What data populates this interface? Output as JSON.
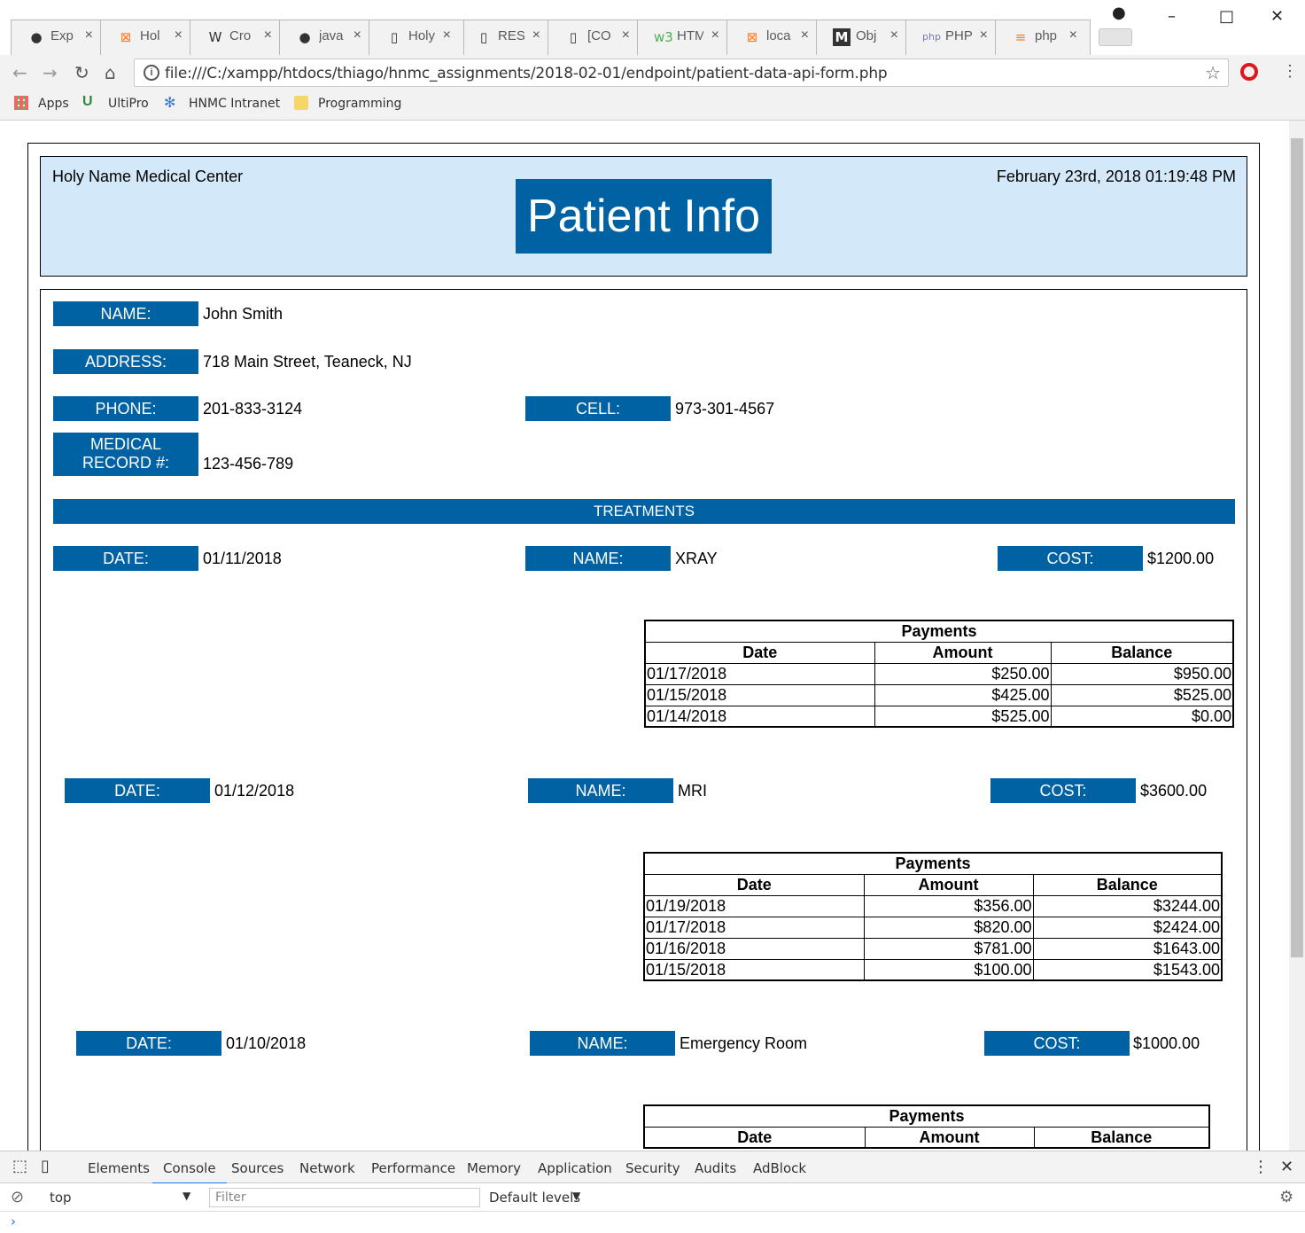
{
  "browser": {
    "tabs": [
      {
        "icon": "github-icon",
        "title": "Exp"
      },
      {
        "icon": "xampp-icon",
        "title": "Hol"
      },
      {
        "icon": "wikipedia-icon",
        "title": "Cro"
      },
      {
        "icon": "github-icon",
        "title": "java"
      },
      {
        "icon": "page-icon",
        "title": "Holy"
      },
      {
        "icon": "page-icon",
        "title": "RES"
      },
      {
        "icon": "page-icon",
        "title": "[CO"
      },
      {
        "icon": "w3-icon",
        "title": "HTM"
      },
      {
        "icon": "xampp-icon",
        "title": "loca"
      },
      {
        "icon": "medium-icon",
        "title": "Obj"
      },
      {
        "icon": "php-icon",
        "title": "PHP"
      },
      {
        "icon": "stackoverflow-icon",
        "title": "php"
      }
    ],
    "url": "file:///C:/xampp/htdocs/thiago/hnmc_assignments/2018-02-01/endpoint/patient-data-api-form.php",
    "bookmarks": [
      "Apps",
      "UltiPro",
      "HNMC Intranet",
      "Programming"
    ]
  },
  "header": {
    "org": "Holy Name Medical Center",
    "title": "Patient Info",
    "datetime": "February 23rd, 2018 01:19:48 PM"
  },
  "patient": {
    "name_label": "NAME:",
    "name": "John Smith",
    "address_label": "ADDRESS:",
    "address": "718 Main Street, Teaneck, NJ",
    "phone_label": "PHONE:",
    "phone": "201-833-3124",
    "cell_label": "CELL:",
    "cell": "973-301-4567",
    "mrn_label_1": "MEDICAL",
    "mrn_label_2": "RECORD #:",
    "mrn": "123-456-789"
  },
  "treatments_heading": "TREATMENTS",
  "labels": {
    "date": "DATE:",
    "name": "NAME:",
    "cost": "COST:"
  },
  "payments_table": {
    "caption": "Payments",
    "col_date": "Date",
    "col_amount": "Amount",
    "col_balance": "Balance"
  },
  "treatments": [
    {
      "date": "01/11/2018",
      "name": "XRAY",
      "cost": "$1200.00",
      "payments": [
        [
          "01/17/2018",
          "$250.00",
          "$950.00"
        ],
        [
          "01/15/2018",
          "$425.00",
          "$525.00"
        ],
        [
          "01/14/2018",
          "$525.00",
          "$0.00"
        ]
      ]
    },
    {
      "date": "01/12/2018",
      "name": "MRI",
      "cost": "$3600.00",
      "payments": [
        [
          "01/19/2018",
          "$356.00",
          "$3244.00"
        ],
        [
          "01/17/2018",
          "$820.00",
          "$2424.00"
        ],
        [
          "01/16/2018",
          "$781.00",
          "$1643.00"
        ],
        [
          "01/15/2018",
          "$100.00",
          "$1543.00"
        ]
      ]
    },
    {
      "date": "01/10/2018",
      "name": "Emergency Room",
      "cost": "$1000.00",
      "payments": []
    }
  ],
  "devtools": {
    "tabs": [
      "Elements",
      "Console",
      "Sources",
      "Network",
      "Performance",
      "Memory",
      "Application",
      "Security",
      "Audits",
      "AdBlock"
    ],
    "context": "top",
    "filter_placeholder": "Filter",
    "levels": "Default levels"
  }
}
